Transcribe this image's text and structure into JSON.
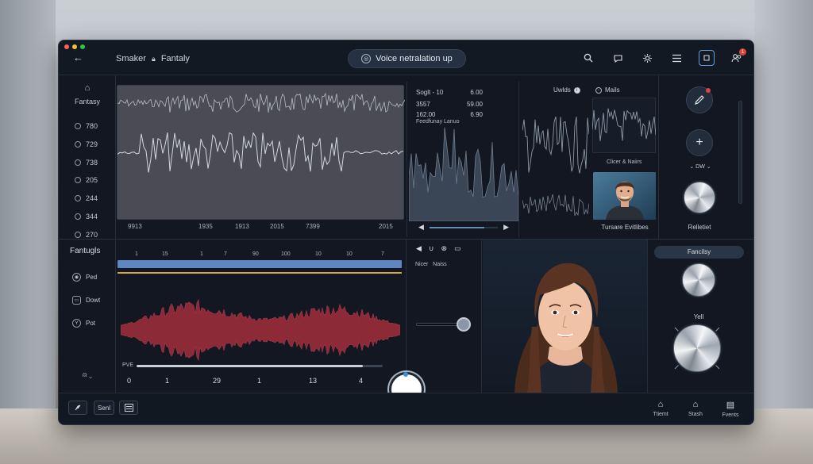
{
  "window": {
    "back_icon": "back-arrow-icon",
    "title_part1": "Smaker",
    "title_part2": "Fantaly",
    "pill_label": "Voice netralation up",
    "dot_colors": [
      "#ff5f57",
      "#febc2e",
      "#28c840"
    ],
    "badge_count": "1"
  },
  "rail_top": {
    "heading": "Fantasy",
    "items": [
      "780",
      "729",
      "738",
      "205",
      "244",
      "344",
      "270"
    ]
  },
  "wave_ticks": [
    "9913",
    "1935",
    "1913",
    "2015",
    "7399",
    "2015"
  ],
  "mid_panel": {
    "rows": [
      {
        "k": "Soglt - 10",
        "v": "6.00"
      },
      {
        "k": "3557",
        "v": "59.00"
      },
      {
        "k": "162.00",
        "v": "6.90"
      }
    ],
    "subtitle": "Feedfunay Lanuo",
    "slider_value": 0.8
  },
  "right_panel": {
    "head1": "Uwlds",
    "head2": "Mails",
    "caption_small": "Clicer & Naiirs",
    "caption": "Tursare Evitlibes"
  },
  "right_controls": {
    "dropdown_label": "DW",
    "knob_label": "Relletiet"
  },
  "bottom": {
    "section_title": "Fantugls",
    "rail_items": [
      "Ped",
      "Dowt",
      "Pot"
    ],
    "footer_label": "Dx",
    "timeline_ticks": [
      "1",
      "15",
      "1",
      "7",
      "90",
      "100",
      "10",
      "10",
      "7"
    ],
    "progress_label": "PVE",
    "progress": 0.92,
    "numbers": [
      "0",
      "1",
      "29",
      "1",
      "13",
      "4"
    ],
    "mid_label": "Nicer   Naiss",
    "mid_slider": 0.95,
    "fancy_label": "Fancilsy",
    "yell_label": "Yell"
  },
  "footer": {
    "btn2": "Senl",
    "nav": [
      "Ttiemt",
      "Stash",
      "Fvents"
    ]
  },
  "colors": {
    "accent_blue": "#5e86c0",
    "gold_line": "#d9a73a",
    "wave_red": "#8c2a38"
  }
}
